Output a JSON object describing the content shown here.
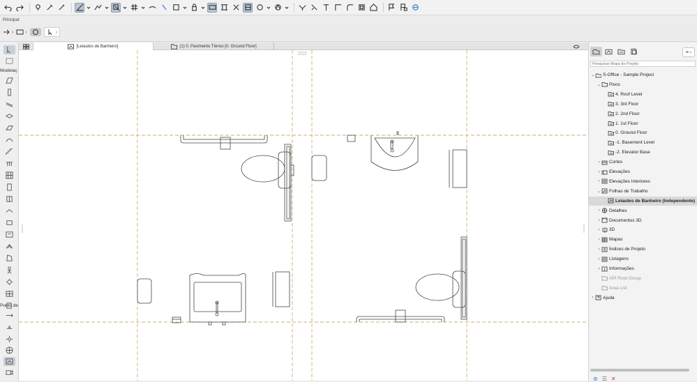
{
  "toolbar": {
    "icons": [
      "undo-icon",
      "redo-icon",
      "pick-up-icon",
      "eyedropper-icon",
      "inject-icon",
      "magic-wand-icon",
      "guide-line-icon",
      "snap-icon",
      "grid-icon",
      "trace-icon",
      "layer-icon",
      "lock-icon",
      "group-icon",
      "suspend-group-icon",
      "fit-icon",
      "zoom-icon",
      "3d-navigation-icon",
      "render-icon",
      "measure-icon",
      "fly-icon",
      "section-icon",
      "selection-icon",
      "flag-icon",
      "flag-settings-icon",
      "teamwork-icon"
    ]
  },
  "infobox": {
    "label": "Principal:"
  },
  "toolbox": {
    "category_modelacao": "Modelaç",
    "category_ponto_de_vista": "Ponto de"
  },
  "tabs": [
    {
      "label": "[Leiautes de Banheiro]",
      "active": true
    },
    {
      "label": "(1) 0. Pavimento Térreo [0. Ground Floor]",
      "active": false
    }
  ],
  "canvas": {
    "zoom_indicator": "⌂"
  },
  "navigator": {
    "search_placeholder": "Pesquisar Mapa de Projeto",
    "tree": [
      {
        "label": "S-Office - Sample Project",
        "level": 0,
        "arrow": "⌄",
        "icon": "project-icon"
      },
      {
        "label": "Pisos",
        "level": 1,
        "arrow": "⌄",
        "icon": "folder-icon"
      },
      {
        "label": "4. Roof Level",
        "level": 2,
        "arrow": "",
        "icon": "story-icon"
      },
      {
        "label": "3. 3rd Floor",
        "level": 2,
        "arrow": "",
        "icon": "story-icon"
      },
      {
        "label": "2. 2nd Floor",
        "level": 2,
        "arrow": "",
        "icon": "story-icon"
      },
      {
        "label": "1. 1st Floor",
        "level": 2,
        "arrow": "",
        "icon": "story-icon"
      },
      {
        "label": "0. Ground Floor",
        "level": 2,
        "arrow": "",
        "icon": "story-icon"
      },
      {
        "label": "-1. Basement Level",
        "level": 2,
        "arrow": "",
        "icon": "story-icon"
      },
      {
        "label": "-2. Elevator Base",
        "level": 2,
        "arrow": "",
        "icon": "story-icon"
      },
      {
        "label": "Cortes",
        "level": 1,
        "arrow": "›",
        "icon": "section-icon"
      },
      {
        "label": "Elevações",
        "level": 1,
        "arrow": "›",
        "icon": "elevation-icon"
      },
      {
        "label": "Elevações Interiores",
        "level": 1,
        "arrow": "›",
        "icon": "interior-elevation-icon"
      },
      {
        "label": "Folhas de Trabalho",
        "level": 1,
        "arrow": "⌄",
        "icon": "worksheet-icon"
      },
      {
        "label": "Leiautes de Banheiro (Independente)",
        "level": 2,
        "arrow": "",
        "icon": "worksheet-icon",
        "selected": true
      },
      {
        "label": "Detalhes",
        "level": 1,
        "arrow": "›",
        "icon": "detail-icon"
      },
      {
        "label": "Documentos 3D",
        "level": 1,
        "arrow": "›",
        "icon": "document-3d-icon"
      },
      {
        "label": "3D",
        "level": 1,
        "arrow": "›",
        "icon": "cube-icon"
      },
      {
        "label": "Mapas",
        "level": 1,
        "arrow": "›",
        "icon": "schedule-icon"
      },
      {
        "label": "Índices de Projeto",
        "level": 1,
        "arrow": "›",
        "icon": "index-icon"
      },
      {
        "label": "Listagens",
        "level": 1,
        "arrow": "›",
        "icon": "list-icon"
      },
      {
        "label": "Informações",
        "level": 1,
        "arrow": "›",
        "icon": "info-icon"
      },
      {
        "label": "API Root Group",
        "level": 1,
        "arrow": "",
        "icon": "folder-icon",
        "greyed": true
      },
      {
        "label": "Area List",
        "level": 1,
        "arrow": "",
        "icon": "folder-icon",
        "greyed": true
      },
      {
        "label": "Ajuda",
        "level": 0,
        "arrow": "›",
        "icon": "help-icon"
      }
    ]
  },
  "colors": {
    "grid_line": "#c7b27a",
    "selection": "#d9d9d9",
    "active_tab": "#ffffff",
    "error_red": "#d0392b",
    "accent_blue": "#2d6fd6"
  }
}
